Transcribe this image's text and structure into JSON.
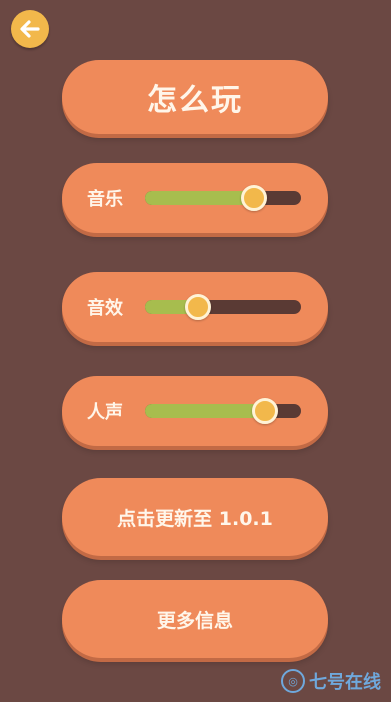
{
  "header": {
    "back_icon": "arrow-left-icon"
  },
  "menu": {
    "how_to_play": "怎么玩",
    "sliders": [
      {
        "label": "音乐",
        "level": 0.7
      },
      {
        "label": "音效",
        "level": 0.34
      },
      {
        "label": "人声",
        "level": 0.77
      }
    ],
    "update_label": "点击更新至 1.0.1",
    "more_info_label": "更多信息"
  },
  "watermark": {
    "text": "七号在线"
  },
  "colors": {
    "background": "#6b4843",
    "button": "#ef8a5a",
    "accent": "#f2b84b",
    "slider_fill": "#a7bd4e",
    "slider_track": "#5a3a34"
  }
}
